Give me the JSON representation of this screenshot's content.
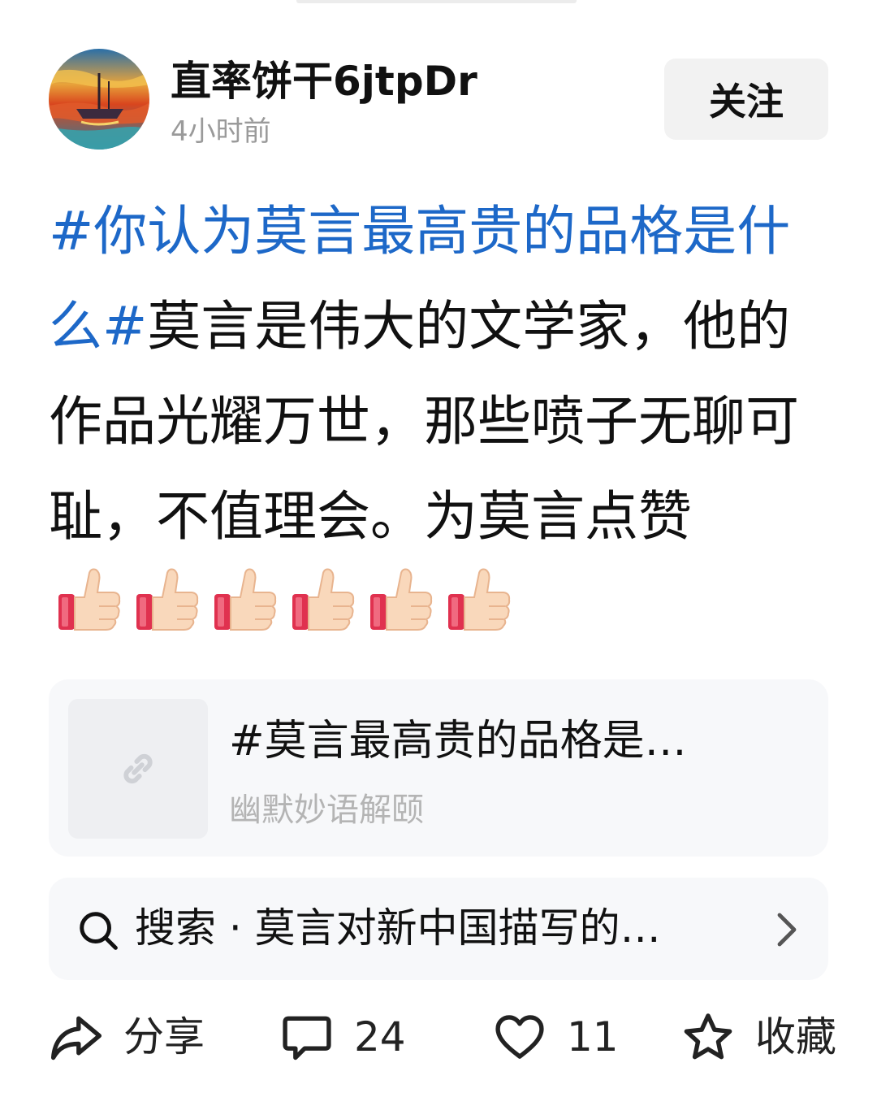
{
  "post": {
    "author": "直率饼干6jtpDr",
    "time": "4小时前",
    "follow_label": "关注",
    "body": {
      "hashtag": "#你认为莫言最高贵的品格是什么#",
      "text": "莫言是伟大的文学家，他的作品光耀万世，那些喷子无聊可耻，不值理会。为莫言点赞",
      "thumbs_emoji_count": 6
    }
  },
  "link_card": {
    "title": "#莫言最高贵的品格是…",
    "subtitle": "幽默妙语解颐",
    "icon": "link-icon"
  },
  "search": {
    "text": "搜索 · 莫言对新中国描写的…",
    "icon": "search-icon"
  },
  "actions": {
    "share_label": "分享",
    "comment_count": "24",
    "like_count": "11",
    "favorite_label": "收藏"
  },
  "colors": {
    "hashtag": "#1d68c8",
    "secondary_text": "#9a9a9a",
    "card_bg": "#f7f8fa",
    "follow_bg": "#f2f2f2"
  }
}
